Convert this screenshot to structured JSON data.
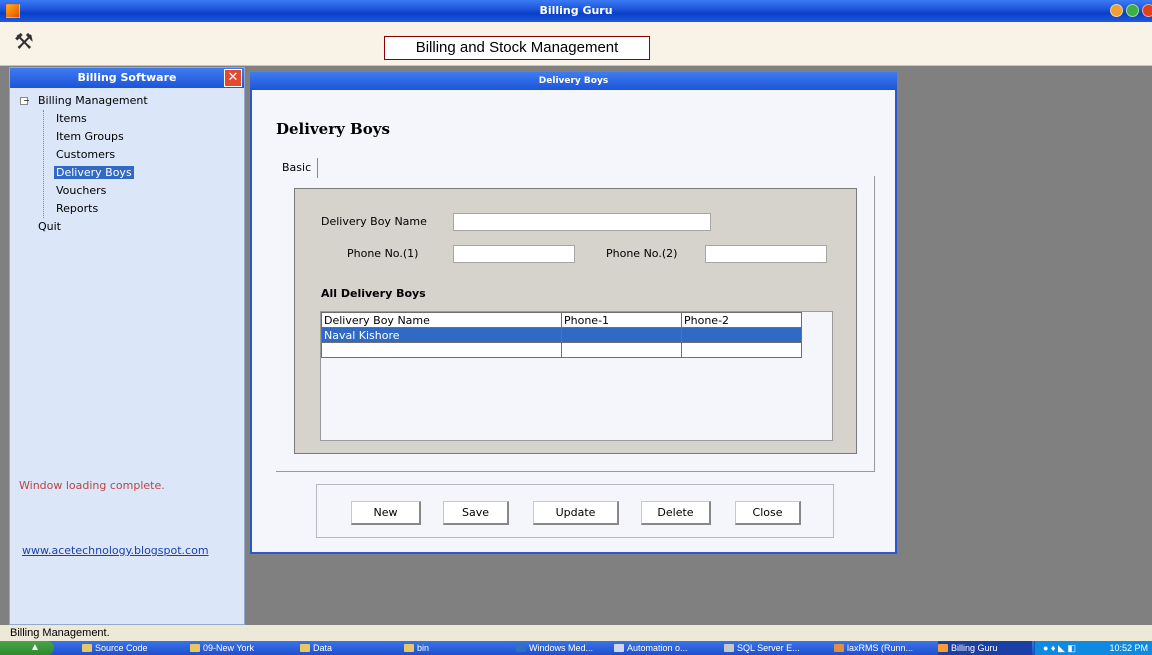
{
  "window": {
    "title": "Billing Guru"
  },
  "toolbar": {
    "icon": "tools-icon",
    "banner": "Billing and Stock Management"
  },
  "sidebar": {
    "title": "Billing Software",
    "close_icon": "close-icon",
    "tree": {
      "root": "Billing Management",
      "expander": "−",
      "items": [
        "Items",
        "Item Groups",
        "Customers",
        "Delivery Boys",
        "Vouchers",
        "Reports"
      ],
      "selected": "Delivery Boys",
      "quit": "Quit"
    },
    "status": "Window loading complete.",
    "link": "www.acetechnology.blogspot.com"
  },
  "child_window": {
    "title": "Delivery Boys",
    "form_title": "Delivery Boys",
    "tab": "Basic",
    "fields": {
      "name_label": "Delivery Boy Name",
      "name_value": "",
      "phone1_label": "Phone No.(1)",
      "phone1_value": "",
      "phone2_label": "Phone No.(2)",
      "phone2_value": ""
    },
    "grid": {
      "title": "All Delivery Boys",
      "columns": [
        "Delivery Boy Name",
        "Phone-1",
        "Phone-2"
      ],
      "rows": [
        [
          "Naval Kishore",
          "",
          ""
        ]
      ]
    },
    "buttons": {
      "new": "New",
      "save": "Save",
      "update": "Update",
      "delete": "Delete",
      "close": "Close"
    }
  },
  "statusbar": {
    "text": "Billing Management."
  },
  "taskbar": {
    "items": [
      "Source Code",
      "09-New York",
      "Data",
      "bin",
      "Windows Med...",
      "Automation o...",
      "SQL Server E...",
      "laxRMS (Runn...",
      "Billing Guru"
    ],
    "clock": "10:52 PM"
  },
  "colors": {
    "title_blue": "#1c55d9",
    "selection": "#316ac5",
    "sidebar_bg": "#dbe6f8",
    "mdi_bg": "#808080"
  }
}
